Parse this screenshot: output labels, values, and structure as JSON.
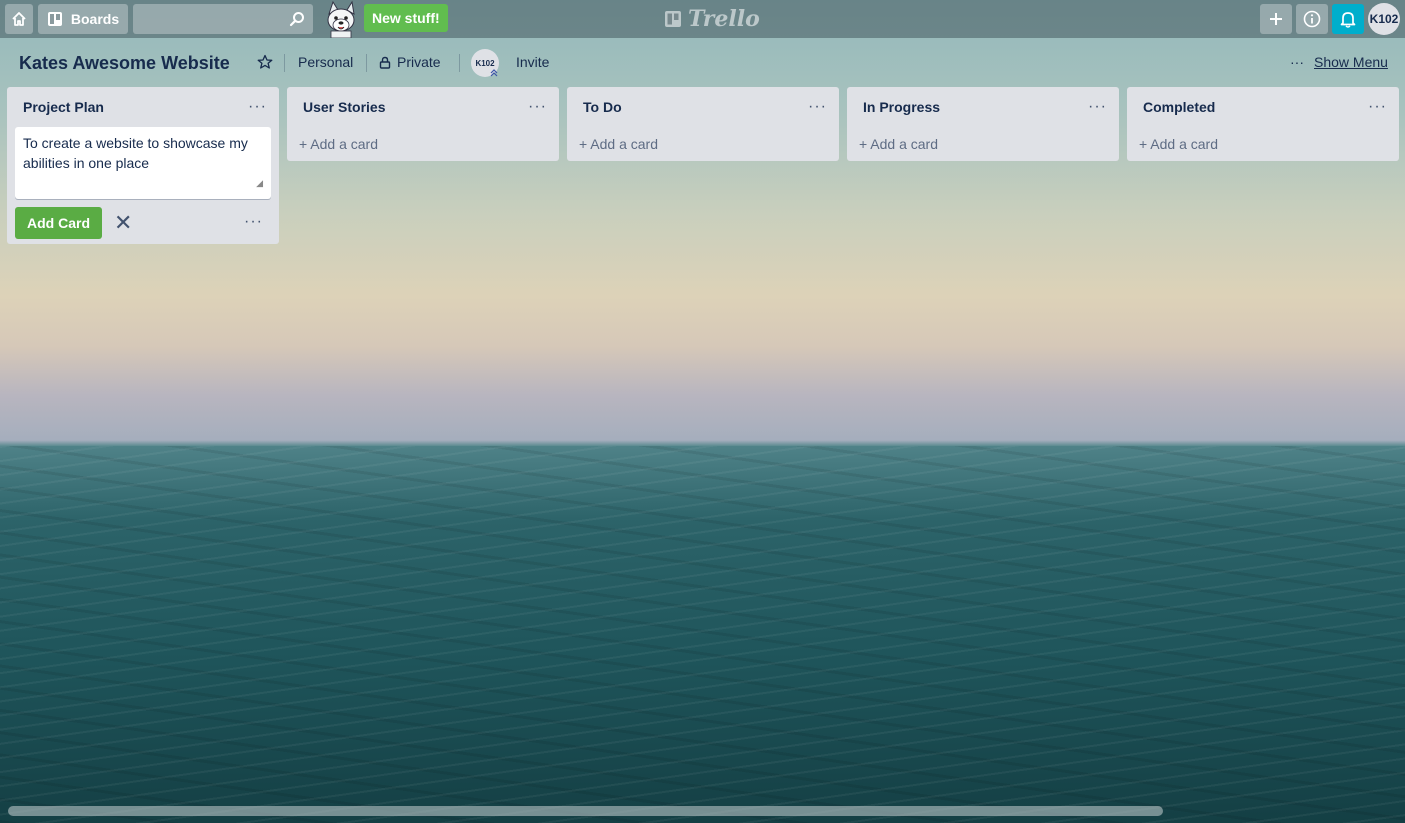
{
  "header": {
    "boards_label": "Boards",
    "new_stuff_label": "New stuff!",
    "logo_text": "Trello",
    "avatar_initials": "K102"
  },
  "board": {
    "title": "Kates Awesome Website",
    "team": "Personal",
    "visibility": "Private",
    "member_initials": "K102",
    "invite_label": "Invite",
    "show_menu_label": "Show Menu",
    "more_label": "···"
  },
  "lists": [
    {
      "title": "Project Plan",
      "menu": "···"
    },
    {
      "title": "User Stories",
      "menu": "···",
      "add_card": "+ Add a card"
    },
    {
      "title": "To Do",
      "menu": "···",
      "add_card": "+ Add a card"
    },
    {
      "title": "In Progress",
      "menu": "···",
      "add_card": "+ Add a card"
    },
    {
      "title": "Completed",
      "menu": "···",
      "add_card": "+ Add a card"
    }
  ],
  "composer": {
    "text": "To create a website to showcase my abilities in one place",
    "add_button_label": "Add Card",
    "close_glyph": "✕",
    "more_label": "···"
  },
  "colors": {
    "accent_green": "#5aac44",
    "new_stuff_green": "#61bd4f",
    "notification_blue": "#00aecc",
    "list_bg": "#dfe1e6"
  }
}
